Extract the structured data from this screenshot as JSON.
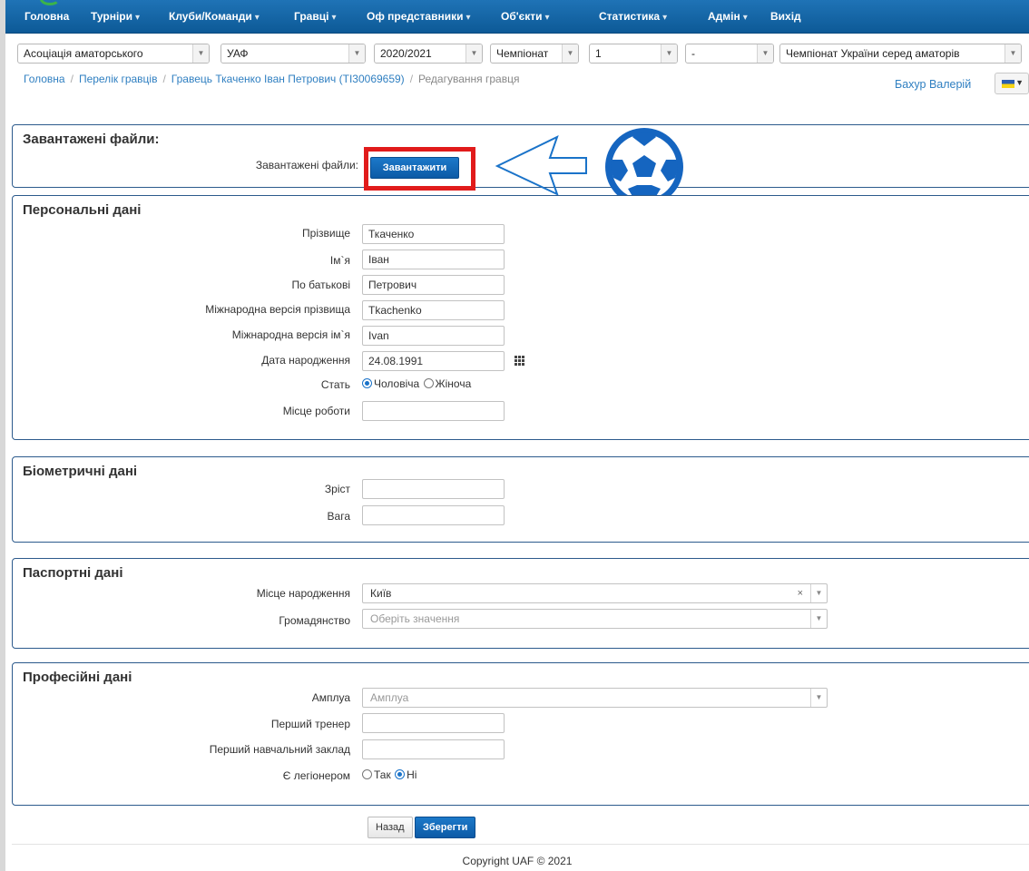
{
  "nav": {
    "items": [
      {
        "label": "Головна",
        "caret": false
      },
      {
        "label": "Турніри",
        "caret": true
      },
      {
        "label": "Клуби/Команди",
        "caret": true
      },
      {
        "label": "Гравці",
        "caret": true
      },
      {
        "label": "Оф представники",
        "caret": true
      },
      {
        "label": "Об'єкти",
        "caret": true
      },
      {
        "label": "Статистика",
        "caret": true
      },
      {
        "label": "Адмін",
        "caret": true
      },
      {
        "label": "Вихід",
        "caret": false
      }
    ]
  },
  "filters": {
    "association": "Асоціація аматорського",
    "federation": "УАФ",
    "season": "2020/2021",
    "type": "Чемпіонат",
    "level": "1",
    "group": "-",
    "tournament": "Чемпіонат України серед аматорів"
  },
  "breadcrumb": {
    "home": "Головна",
    "players": "Перелік гравців",
    "player": "Гравець Ткаченко Іван Петрович (TI30069659)",
    "current": "Редагування гравця"
  },
  "user": {
    "name": "Бахур Валерій"
  },
  "files": {
    "title": "Завантажені файли:",
    "label": "Завантажені файли:",
    "upload_button": "Завантажити"
  },
  "personal": {
    "title": "Персональні дані",
    "surname_label": "Прізвище",
    "surname": "Ткаченко",
    "name_label": "Ім`я",
    "name": "Іван",
    "patronymic_label": "По батькові",
    "patronymic": "Петрович",
    "intl_surname_label": "Міжнародна версія прізвища",
    "intl_surname": "Tkachenko",
    "intl_name_label": "Міжнародна версія ім`я",
    "intl_name": "Ivan",
    "birth_label": "Дата народження",
    "birth": "24.08.1991",
    "gender_label": "Стать",
    "gender_male": "Чоловіча",
    "gender_female": "Жіноча",
    "work_label": "Місце роботи",
    "work": ""
  },
  "biometric": {
    "title": "Біометричні дані",
    "height_label": "Зріст",
    "height": "",
    "weight_label": "Вага",
    "weight": ""
  },
  "passport": {
    "title": "Паспортні дані",
    "birthplace_label": "Місце народження",
    "birthplace": "Київ",
    "citizenship_label": "Громадянство",
    "citizenship_placeholder": "Оберіть значення"
  },
  "professional": {
    "title": "Професійні дані",
    "role_label": "Амплуа",
    "role_placeholder": "Амплуа",
    "coach_label": "Перший тренер",
    "coach": "",
    "school_label": "Перший навчальний заклад",
    "school": "",
    "legionnaire_label": "Є легіонером",
    "yes": "Так",
    "no": "Ні"
  },
  "actions": {
    "back": "Назад",
    "save": "Зберегти"
  },
  "footer": {
    "copyright": "Copyright UAF ©  2021"
  },
  "colors": {
    "nav": "#1466a8",
    "accent": "#2f7fc1",
    "highlight": "#e11b1b",
    "annotation": "#1a73c9"
  }
}
